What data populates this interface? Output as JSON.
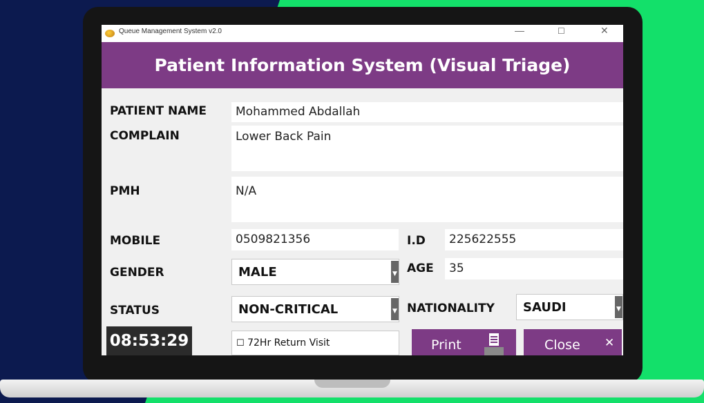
{
  "window": {
    "title": "Queue Management System v2.0",
    "minimize_glyph": "—",
    "maximize_glyph": "☐",
    "close_glyph": "✕"
  },
  "header": {
    "title": "Patient Information System (Visual Triage)"
  },
  "form": {
    "patient_name_label": "PATIENT NAME",
    "patient_name_value": "Mohammed Abdallah",
    "complain_label": "COMPLAIN",
    "complain_value": "Lower Back Pain",
    "pmh_label": "PMH",
    "pmh_value": "N/A",
    "mobile_label": "MOBILE",
    "mobile_value": "0509821356",
    "id_label": "I.D",
    "id_value": "225622555",
    "gender_label": "GENDER",
    "gender_value": "MALE",
    "age_label": "AGE",
    "age_value": "35",
    "status_label": "STATUS",
    "status_value": "NON-CRITICAL",
    "nationality_label": "NATIONALITY",
    "nationality_value": "SAUDI",
    "clock": "08:53:29",
    "return_visit_checkbox": "☐",
    "return_visit_label": "72Hr Return Visit",
    "print_label": "Print",
    "close_label": "Close",
    "close_glyph": "✕"
  },
  "colors": {
    "header_purple": "#7d3b85",
    "background_navy": "#0c1a4f",
    "background_green": "#13e06a"
  },
  "icons": [
    "app-icon",
    "print-icon",
    "close-icon",
    "dropdown-arrow-icon"
  ]
}
